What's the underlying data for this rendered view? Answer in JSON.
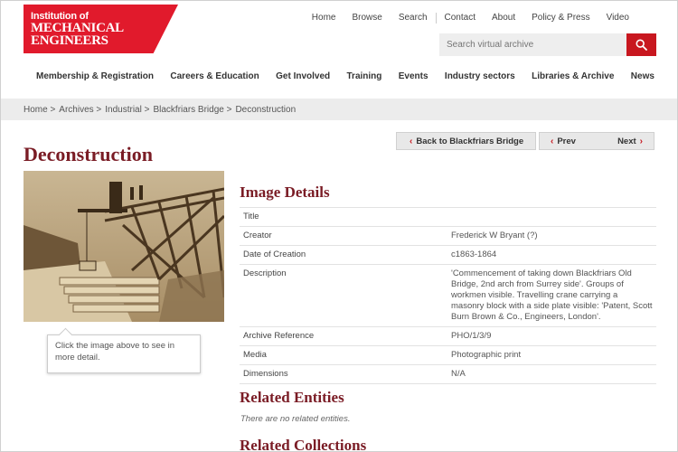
{
  "logo": {
    "line1": "Institution of",
    "line2": "MECHANICAL",
    "line3": "ENGINEERS"
  },
  "topnav": [
    "Home",
    "Browse",
    "Search",
    "Contact",
    "About",
    "Policy & Press",
    "Video"
  ],
  "search": {
    "placeholder": "Search virtual archive"
  },
  "mainnav": [
    "Membership & Registration",
    "Careers & Education",
    "Get Involved",
    "Training",
    "Events",
    "Industry sectors",
    "Libraries & Archive",
    "News"
  ],
  "breadcrumb": [
    "Home >",
    "Archives >",
    "Industrial >",
    "Blackfriars Bridge >",
    "Deconstruction"
  ],
  "page": {
    "title": "Deconstruction",
    "back_label": "Back to Blackfriars Bridge",
    "prev_label": "Prev",
    "next_label": "Next",
    "tooltip": "Click the image above to see in more detail."
  },
  "image_details": {
    "heading": "Image Details",
    "rows": [
      {
        "label": "Title",
        "value": ""
      },
      {
        "label": "Creator",
        "value": "Frederick W Bryant (?)"
      },
      {
        "label": "Date of Creation",
        "value": "c1863-1864"
      },
      {
        "label": "Description",
        "value": "'Commencement of taking down Blackfriars Old Bridge, 2nd arch from Surrey side'. Groups of workmen visible. Travelling crane carrying a masonry block with a side plate visible: 'Patent, Scott Burn Brown & Co., Engineers, London'."
      },
      {
        "label": "Archive Reference",
        "value": "PHO/1/3/9"
      },
      {
        "label": "Media",
        "value": "Photographic print"
      },
      {
        "label": "Dimensions",
        "value": "N/A"
      }
    ]
  },
  "related_entities": {
    "heading": "Related Entities",
    "empty_text": "There are no related entities."
  },
  "related_collections": {
    "heading": "Related Collections"
  },
  "colors": {
    "brand_red": "#e11a2c",
    "heading_maroon": "#7a1c25",
    "search_btn": "#c8171f"
  },
  "icons": {
    "search": "search-icon",
    "prev": "chevron-left-icon",
    "next": "chevron-right-icon"
  }
}
